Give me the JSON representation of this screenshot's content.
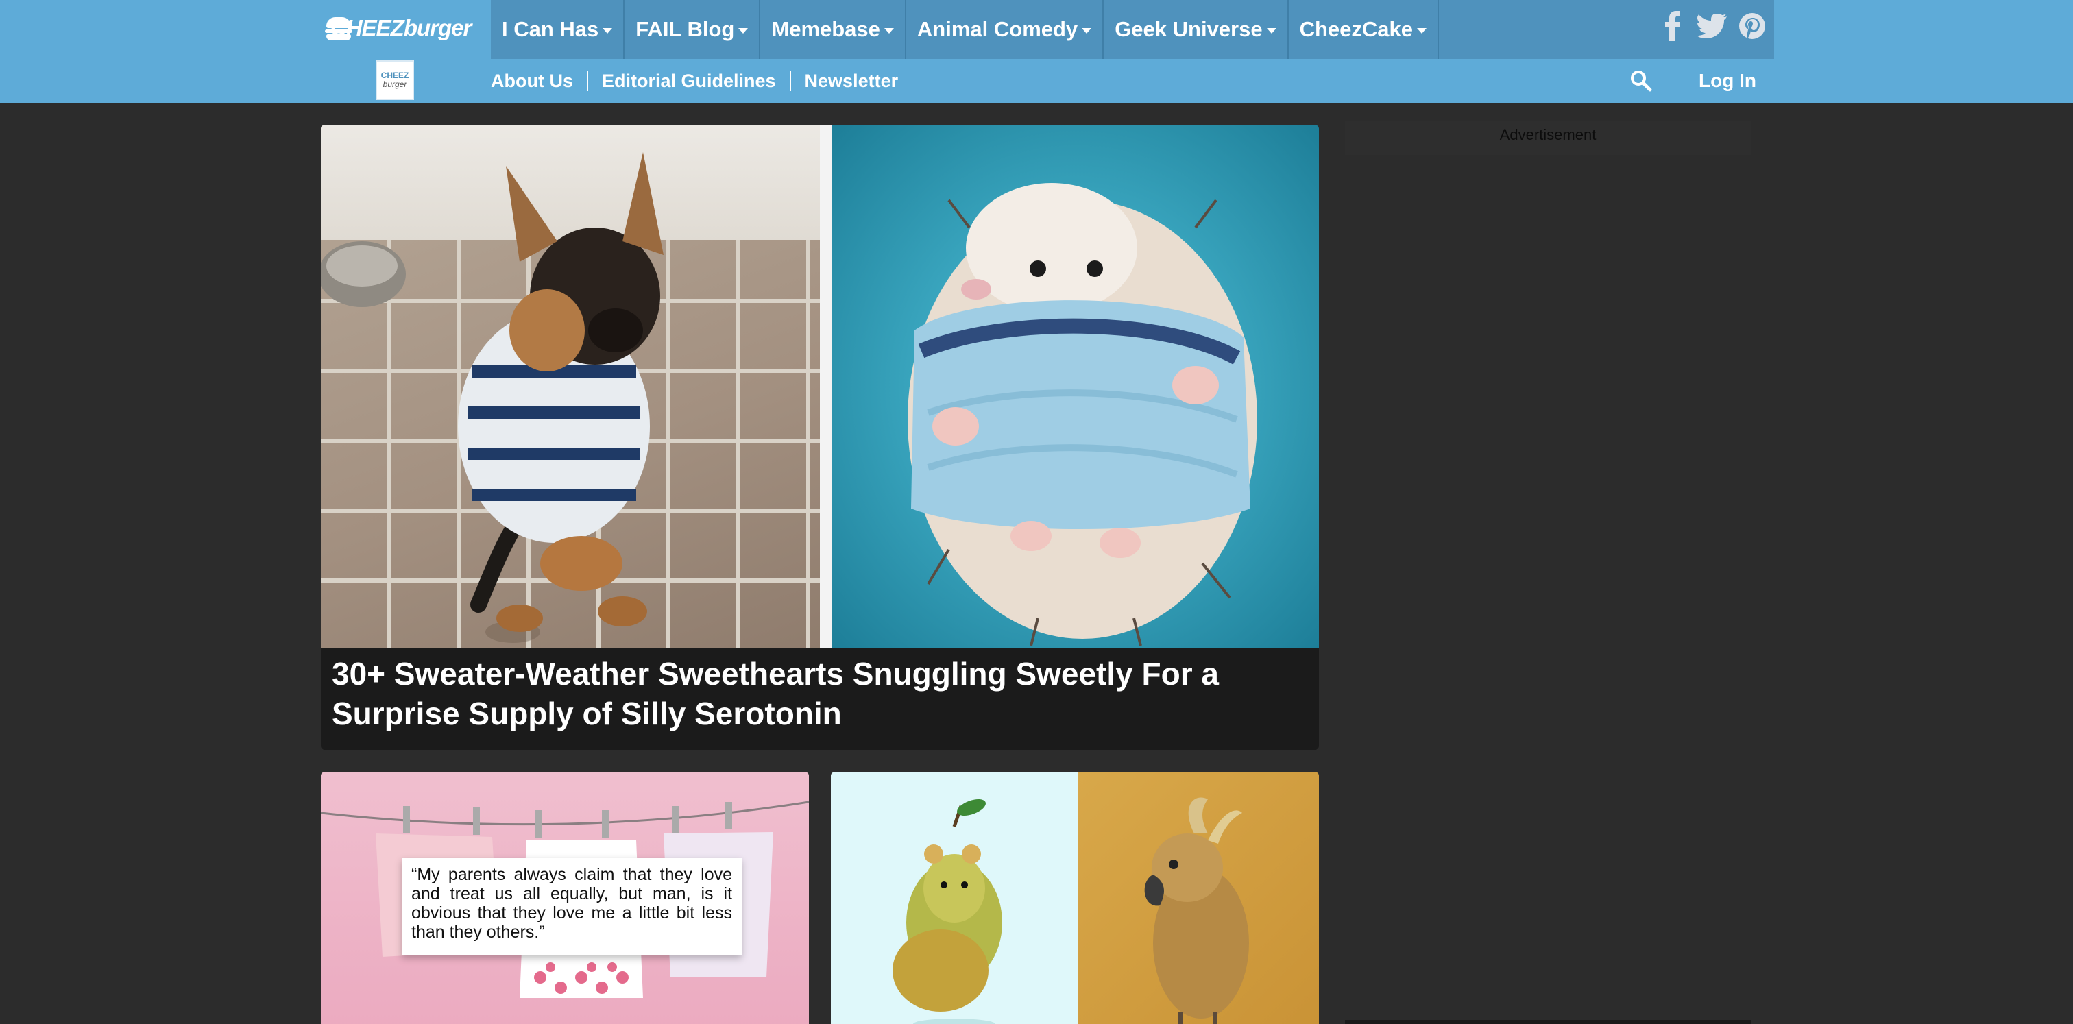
{
  "brand": {
    "logo_text": "CHEEZburger",
    "sub_logo_line1": "CHEEZ",
    "sub_logo_line2": "burger"
  },
  "main_nav": [
    {
      "label": "I Can Has"
    },
    {
      "label": "FAIL Blog"
    },
    {
      "label": "Memebase"
    },
    {
      "label": "Animal Comedy"
    },
    {
      "label": "Geek Universe"
    },
    {
      "label": "CheezCake"
    }
  ],
  "social": [
    "facebook-icon",
    "twitter-icon",
    "pinterest-icon"
  ],
  "sub_nav": [
    {
      "label": "About Us"
    },
    {
      "label": "Editorial Guidelines"
    },
    {
      "label": "Newsletter"
    }
  ],
  "header": {
    "login_label": "Log In"
  },
  "featured": {
    "title": "30+ Sweater-Weather Sweethearts Snuggling Sweetly For a Surprise Supply of Silly Serotonin"
  },
  "cards": {
    "left_quote": "“My parents always claim that they love and treat us all equally, but man, is it obvious that they love me a little bit less than they others.”"
  },
  "sidebar": {
    "ad_label": "Advertisement"
  },
  "colors": {
    "header_bg": "#5eabd8",
    "nav_bg": "#4f92bd",
    "page_bg": "#2c2c2c"
  }
}
